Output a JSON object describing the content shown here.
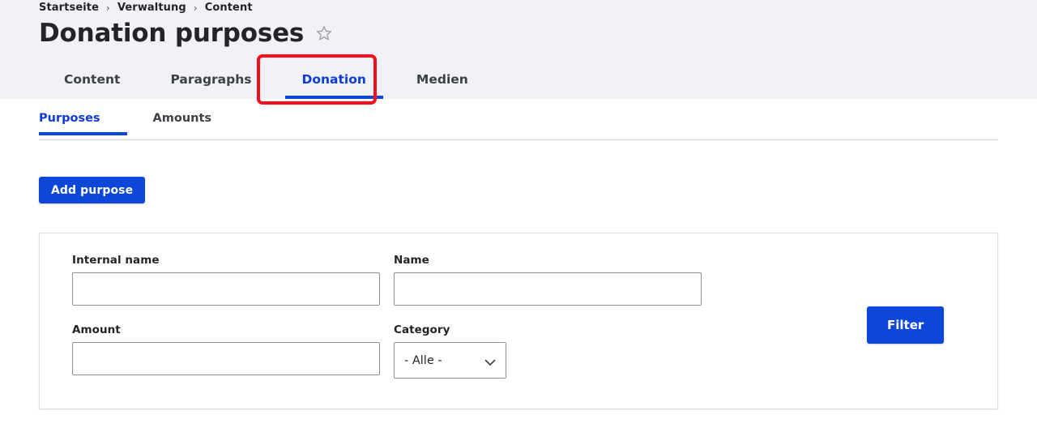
{
  "breadcrumb": {
    "separator": "›",
    "items": [
      {
        "label": "Startseite"
      },
      {
        "label": "Verwaltung"
      },
      {
        "label": "Content"
      }
    ]
  },
  "header": {
    "title": "Donation purposes",
    "favorite_icon": "star-outline-icon"
  },
  "primary_tabs": {
    "items": [
      {
        "label": "Content",
        "active": false
      },
      {
        "label": "Paragraphs",
        "active": false
      },
      {
        "label": "Donation",
        "active": true
      },
      {
        "label": "Medien",
        "active": false
      }
    ],
    "highlight_target": "Donation",
    "highlight_color": "#fc0d1b"
  },
  "secondary_tabs": {
    "items": [
      {
        "label": "Purposes",
        "active": true
      },
      {
        "label": "Amounts",
        "active": false
      }
    ]
  },
  "actions": {
    "add_purpose_label": "Add purpose"
  },
  "filter_form": {
    "fields": {
      "internal_name": {
        "label": "Internal name",
        "value": "",
        "placeholder": ""
      },
      "name": {
        "label": "Name",
        "value": "",
        "placeholder": ""
      },
      "amount": {
        "label": "Amount",
        "value": "",
        "placeholder": ""
      },
      "category": {
        "label": "Category",
        "selected": "- Alle -",
        "icon": "chevron-down-icon"
      }
    },
    "submit_label": "Filter"
  },
  "colors": {
    "accent_blue": "#0d47d9",
    "link_blue": "#0d3bdb",
    "header_bg": "#f1f2f7",
    "text": "#232429",
    "annotation_red": "#fc0d1b",
    "border_gray": "#8e929a"
  }
}
